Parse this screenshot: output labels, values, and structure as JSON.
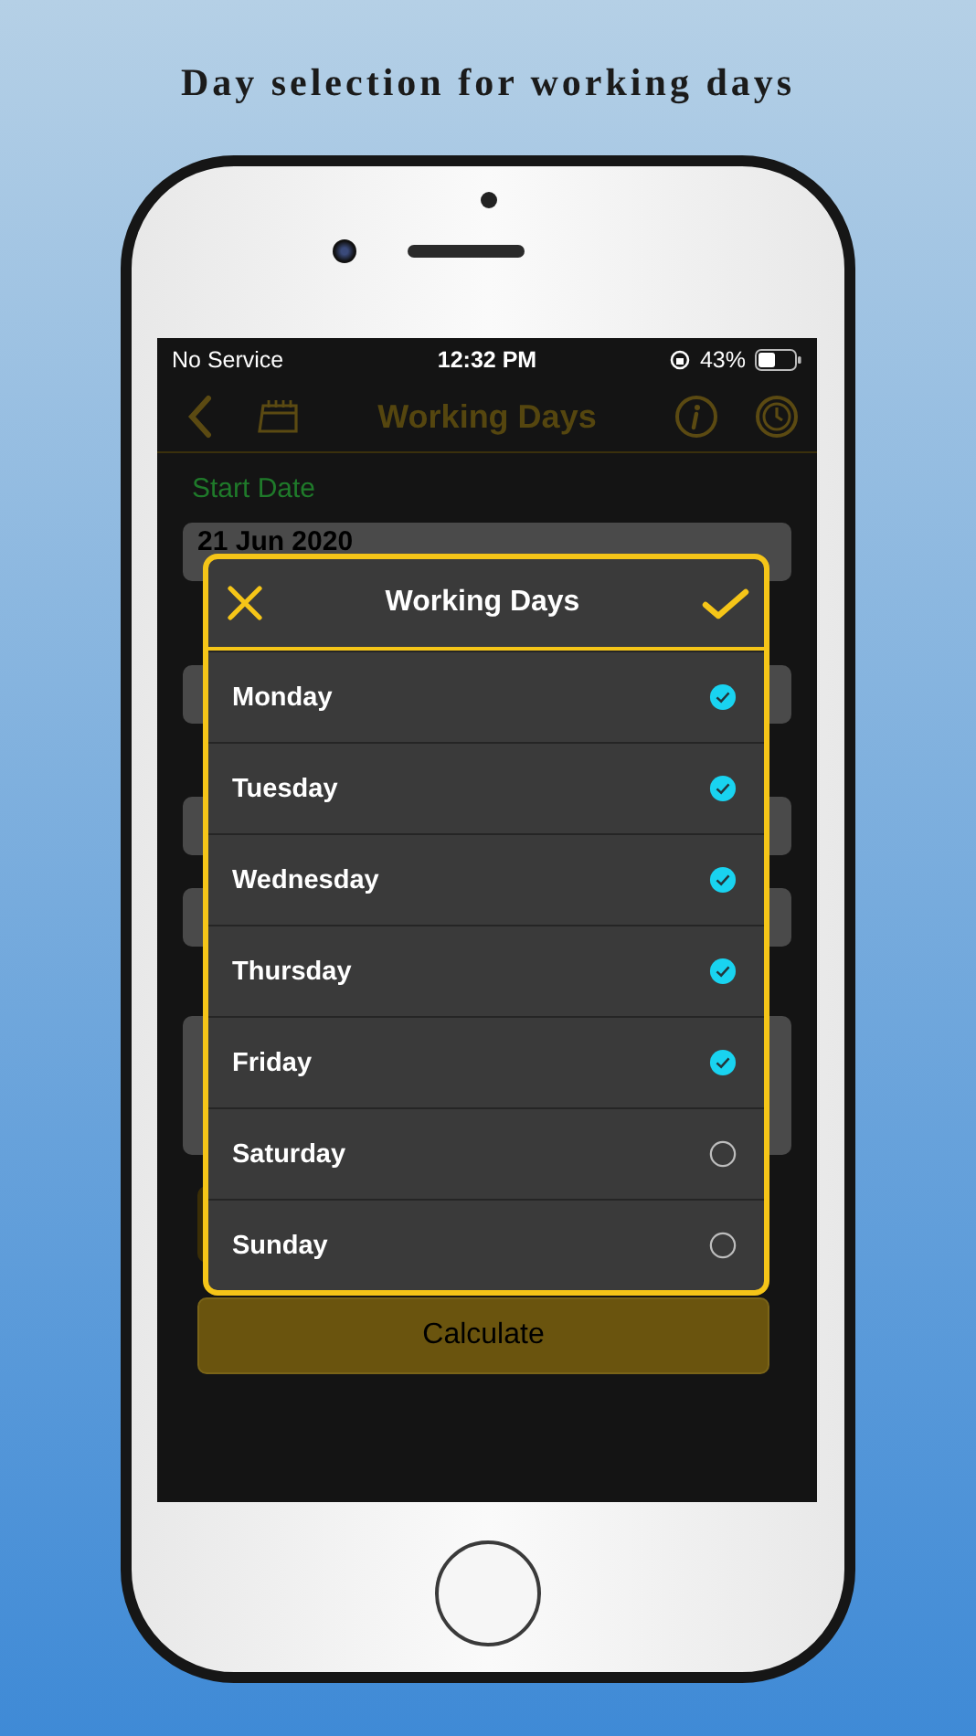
{
  "heading": "Day selection for working days",
  "status_bar": {
    "carrier": "No Service",
    "time": "12:32 PM",
    "battery": "43%"
  },
  "nav": {
    "title": "Working Days"
  },
  "form": {
    "start_label": "Start Date",
    "start_value": "21 Jun 2020",
    "button": "Calculate"
  },
  "dialog": {
    "title": "Working Days",
    "days": [
      {
        "label": "Monday",
        "checked": true
      },
      {
        "label": "Tuesday",
        "checked": true
      },
      {
        "label": "Wednesday",
        "checked": true
      },
      {
        "label": "Thursday",
        "checked": true
      },
      {
        "label": "Friday",
        "checked": true
      },
      {
        "label": "Saturday",
        "checked": false
      },
      {
        "label": "Sunday",
        "checked": false
      }
    ]
  }
}
